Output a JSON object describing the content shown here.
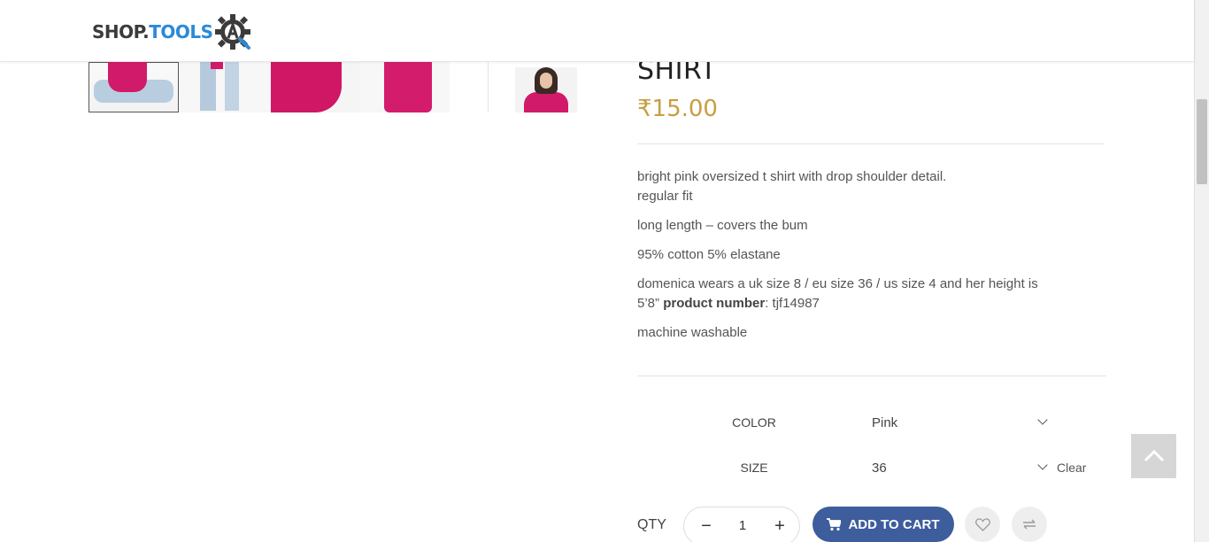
{
  "header": {
    "logo_shop": "SHOP.",
    "logo_tools": "TOOLS",
    "logo_icon": "gear-a-icon"
  },
  "product": {
    "title": "SHIRT",
    "price": "₹15.00",
    "description": {
      "line1": "bright pink oversized t shirt with drop shoulder detail.",
      "line2": "regular fit",
      "line3": "long length – covers the bum",
      "line4": "95% cotton 5% elastane",
      "line5": "domenica wears a uk size 8 / eu size 36 / us size 4 and her height is 5’8”",
      "product_number_label": "product number",
      "product_number_value": ": tjf14987",
      "line6": "machine washable"
    }
  },
  "variations": {
    "color_label": "COLOR",
    "color_value": "Pink",
    "size_label": "SIZE",
    "size_value": "36",
    "clear_label": "Clear"
  },
  "purchase": {
    "qty_label": "QTY",
    "qty_value": "1",
    "minus_symbol": "−",
    "plus_symbol": "+",
    "add_to_cart_label": "ADD TO CART",
    "cart_icon": "cart-icon",
    "wishlist_icon": "heart-icon",
    "compare_icon": "compare-arrows-icon"
  },
  "colors": {
    "price": "#c79e41",
    "button": "#3d5d9c",
    "logo_blue": "#2b8ad8",
    "product_pink": "#d21a6a"
  }
}
